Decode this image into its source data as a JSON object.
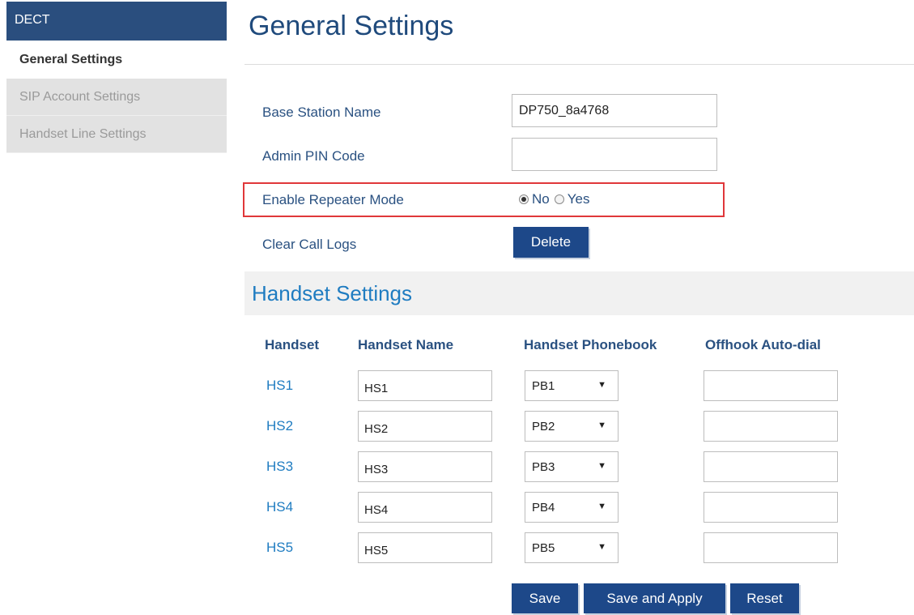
{
  "sidebar": {
    "header": "DECT",
    "items": [
      {
        "label": "General Settings"
      },
      {
        "label": "SIP Account Settings"
      },
      {
        "label": "Handset Line Settings"
      }
    ]
  },
  "page": {
    "title": "General Settings"
  },
  "form": {
    "base_station_label": "Base Station Name",
    "base_station_value": "DP750_8a4768",
    "admin_pin_label": "Admin PIN Code",
    "admin_pin_value": "",
    "repeater_label": "Enable Repeater Mode",
    "repeater_options": [
      "No",
      "Yes"
    ],
    "repeater_selected": "No",
    "clear_logs_label": "Clear Call Logs",
    "delete_label": "Delete"
  },
  "handset": {
    "title": "Handset Settings",
    "columns": [
      "Handset",
      "Handset Name",
      "Handset Phonebook",
      "Offhook Auto-dial"
    ],
    "rows": [
      {
        "id": "HS1",
        "name": "HS1",
        "phonebook": "PB1",
        "autodial": ""
      },
      {
        "id": "HS2",
        "name": "HS2",
        "phonebook": "PB2",
        "autodial": ""
      },
      {
        "id": "HS3",
        "name": "HS3",
        "phonebook": "PB3",
        "autodial": ""
      },
      {
        "id": "HS4",
        "name": "HS4",
        "phonebook": "PB4",
        "autodial": ""
      },
      {
        "id": "HS5",
        "name": "HS5",
        "phonebook": "PB5",
        "autodial": ""
      }
    ]
  },
  "actions": {
    "save": "Save",
    "save_apply": "Save and Apply",
    "reset": "Reset"
  },
  "colors": {
    "sidebar_header": "#2a4e7e",
    "button": "#1d4889",
    "highlight": "#e0373a",
    "section_title": "#1f7cc1"
  },
  "icons": {
    "select_arrow": "triangle-down"
  }
}
